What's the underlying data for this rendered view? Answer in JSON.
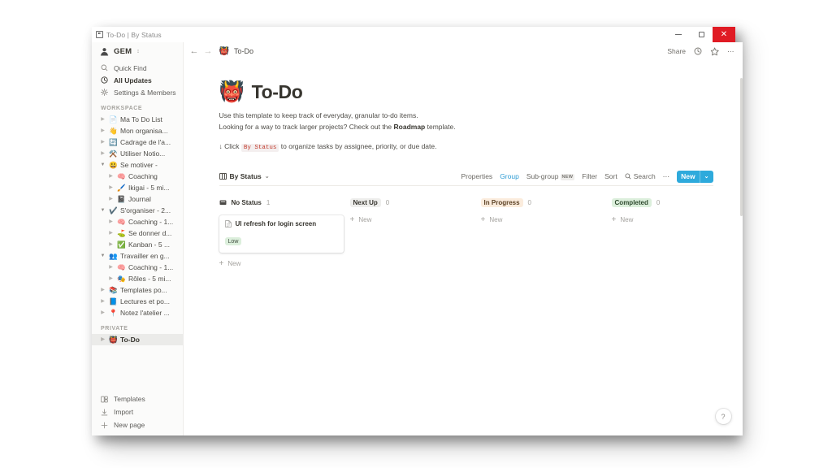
{
  "window": {
    "title": "To-Do  | By Status",
    "logo_icon": "notion-logo-icon",
    "minimize_label": "–",
    "maximize_label": "□",
    "close_label": "✕"
  },
  "sidebar": {
    "workspace": {
      "name": "GEM",
      "avatar_icon": "workspace-avatar-icon",
      "caret_icon": "chevron-updown-icon"
    },
    "nav": [
      {
        "label": "Quick Find",
        "icon": "search-icon",
        "strong": false
      },
      {
        "label": "All Updates",
        "icon": "clock-icon",
        "strong": true
      },
      {
        "label": "Settings & Members",
        "icon": "gear-icon",
        "strong": false
      }
    ],
    "workspace_section_label": "WORKSPACE",
    "workspace_items": [
      {
        "label": "Ma To Do List",
        "emoji": "📄",
        "level": 1,
        "open": false
      },
      {
        "label": "Mon organisa...",
        "emoji": "👋",
        "level": 1,
        "open": false
      },
      {
        "label": "Cadrage de l'a...",
        "emoji": "🔄",
        "level": 1,
        "open": false
      },
      {
        "label": "Utiliser Notio...",
        "emoji": "⚒️",
        "level": 1,
        "open": false
      },
      {
        "label": "Se motiver -",
        "emoji": "😃",
        "level": 1,
        "open": true
      },
      {
        "label": "Coaching",
        "emoji": "🧠",
        "level": 2,
        "open": false
      },
      {
        "label": "Ikigai - 5 mi...",
        "emoji": "🖌️",
        "level": 2,
        "open": false
      },
      {
        "label": "Journal",
        "emoji": "📓",
        "level": 2,
        "open": false
      },
      {
        "label": "S'organiser - 2...",
        "emoji": "✔️",
        "level": 1,
        "open": true
      },
      {
        "label": "Coaching - 1...",
        "emoji": "🧠",
        "level": 2,
        "open": false
      },
      {
        "label": "Se donner d...",
        "emoji": "⛳",
        "level": 2,
        "open": false
      },
      {
        "label": "Kanban - 5 ...",
        "emoji": "✅",
        "level": 2,
        "open": false
      },
      {
        "label": "Travailler en g...",
        "emoji": "👥",
        "level": 1,
        "open": true
      },
      {
        "label": "Coaching - 1...",
        "emoji": "🧠",
        "level": 2,
        "open": false
      },
      {
        "label": "Rôles - 5 mi...",
        "emoji": "🎭",
        "level": 2,
        "open": false
      },
      {
        "label": "Templates po...",
        "emoji": "📚",
        "level": 1,
        "open": false
      },
      {
        "label": "Lectures et po...",
        "emoji": "📘",
        "level": 1,
        "open": false
      },
      {
        "label": "Notez l'atelier ...",
        "emoji": "📍",
        "level": 1,
        "open": false
      }
    ],
    "private_section_label": "PRIVATE",
    "private_items": [
      {
        "label": "To-Do",
        "emoji": "👹",
        "level": 1,
        "active": true
      }
    ],
    "bottom": [
      {
        "label": "Templates",
        "icon": "templates-icon"
      },
      {
        "label": "Import",
        "icon": "import-icon"
      },
      {
        "label": "New page",
        "icon": "plus-icon"
      }
    ]
  },
  "topbar": {
    "back_icon": "arrow-left-icon",
    "forward_icon": "arrow-right-icon",
    "breadcrumb_emoji": "👹",
    "breadcrumb_label": "To-Do",
    "share_label": "Share",
    "updates_icon": "clock-icon",
    "favorite_icon": "star-icon",
    "more_icon": "more-horizontal-icon"
  },
  "page": {
    "emoji": "👹",
    "title": "To-Do",
    "para1_line1": "Use this template to keep track of everyday, granular to-do items.",
    "para1_line2_a": "Looking for a way to track larger projects? Check out the ",
    "para1_link": "Roadmap",
    "para1_line2_b": " template.",
    "para2_a": "↓ Click ",
    "para2_chip": "By Status",
    "para2_b": " to organize tasks by assignee, priority, or due date."
  },
  "viewbar": {
    "view_icon": "board-view-icon",
    "view_name": "By Status",
    "view_caret": "⌄",
    "controls": [
      {
        "label": "Properties",
        "accent": false,
        "badge": ""
      },
      {
        "label": "Group",
        "accent": true,
        "badge": ""
      },
      {
        "label": "Sub-group",
        "accent": false,
        "badge": "NEW"
      },
      {
        "label": "Filter",
        "accent": false,
        "badge": ""
      },
      {
        "label": "Sort",
        "accent": false,
        "badge": ""
      }
    ],
    "search_label": "Search",
    "search_icon": "search-icon",
    "more_label": "⋯",
    "new_label": "New",
    "new_caret": "⌄",
    "accent_color": "#2eaadc"
  },
  "board": {
    "add_new_label": "New",
    "columns": [
      {
        "name": "No Status",
        "count": "1",
        "chip": false,
        "icon": "no-status-icon",
        "bg": "transparent",
        "fg": "#37352f",
        "cards": [
          {
            "title": "UI refresh for login screen",
            "icon": "page-icon",
            "props": [
              {
                "label": "Low",
                "bg": "#dcefdc",
                "fg": "#3f4d3f"
              }
            ]
          }
        ]
      },
      {
        "name": "Next Up",
        "count": "0",
        "chip": true,
        "bg": "#eeeeec",
        "fg": "#37352f",
        "cards": []
      },
      {
        "name": "In Progress",
        "count": "0",
        "chip": true,
        "bg": "#fbecdd",
        "fg": "#5c4225",
        "cards": []
      },
      {
        "name": "Completed",
        "count": "0",
        "chip": true,
        "bg": "#dcefdc",
        "fg": "#2f4a2f",
        "cards": []
      }
    ]
  },
  "help": {
    "label": "?"
  }
}
